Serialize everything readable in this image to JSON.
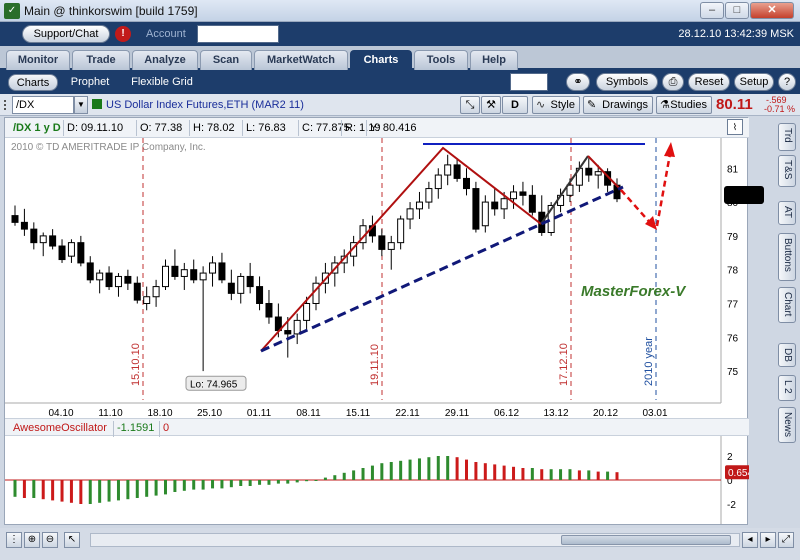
{
  "window": {
    "title": "Main @ thinkorswim [build 1759]",
    "minimize": "–",
    "maximize": "□",
    "close": "✕"
  },
  "toprow": {
    "support": "Support/Chat",
    "alert": "!",
    "account_label": "Account",
    "datetime": "28.12.10 13:42:39 MSK"
  },
  "tabs": [
    {
      "label": "Monitor"
    },
    {
      "label": "Trade"
    },
    {
      "label": "Analyze"
    },
    {
      "label": "Scan"
    },
    {
      "label": "MarketWatch"
    },
    {
      "label": "Charts"
    },
    {
      "label": "Tools"
    },
    {
      "label": "Help"
    }
  ],
  "subtabs": [
    {
      "label": "Charts"
    },
    {
      "label": "Prophet"
    },
    {
      "label": "Flexible Grid"
    }
  ],
  "subrow_buttons": {
    "symbols": "Symbols",
    "reset": "Reset",
    "setup": "Setup"
  },
  "symbol_bar": {
    "symbol": "/DX",
    "description": "US Dollar Index Futures,ETH (MAR2 11)",
    "d_button": "D",
    "style": "Style",
    "drawings": "Drawings",
    "studies": "Studies",
    "last": "80.11",
    "net_change": "-.569",
    "pct_change": "-0.71 %"
  },
  "studies_bar": {
    "symbol": "/DX 1 y D",
    "date": "D: 09.11.10",
    "open": "O: 77.38",
    "high": "H: 78.02",
    "low": "L: 76.83",
    "close": "C: 77.875",
    "range": "R: 1.19",
    "y": "Y: 80.416"
  },
  "copyright": "2010 © TD AMERITRADE IP Company, Inc.",
  "annotations": {
    "low_label": "Lo: 74.965",
    "watermark": "MasterForex-V",
    "v1": "15.10.10",
    "v2": "19.11.10",
    "v3": "17.12.10",
    "v4": "2010 year"
  },
  "oscillator": {
    "name": "AwesomeOscillator",
    "value": "-1.1591",
    "zero": "0",
    "current": "0.65463"
  },
  "side_tabs": [
    {
      "label": "Trd"
    },
    {
      "label": "T&S"
    },
    {
      "label": "AT"
    },
    {
      "label": "Buttons"
    },
    {
      "label": "Chart"
    },
    {
      "label": "DB"
    },
    {
      "label": "L 2"
    },
    {
      "label": "News"
    }
  ],
  "colors": {
    "up": "#000000",
    "down": "#000000",
    "red_line": "#b01010",
    "blue_line": "#1020c0",
    "navy_dash": "#101878",
    "osc_green": "#2e8b2e",
    "osc_red": "#cc1a1a"
  },
  "chart_data": {
    "type": "candlestick",
    "price_axis": {
      "ticks": [
        "81",
        "80",
        "79",
        "78",
        "77",
        "76",
        "75"
      ],
      "range": [
        74.5,
        81.6
      ]
    },
    "date_ticks": [
      "04.10",
      "11.10",
      "18.10",
      "25.10",
      "01.11",
      "08.11",
      "15.11",
      "22.11",
      "29.11",
      "06.12",
      "13.12",
      "20.12",
      "03.01"
    ],
    "candles": [
      [
        79.6,
        79.9,
        79.3,
        79.4
      ],
      [
        79.4,
        79.8,
        79.0,
        79.2
      ],
      [
        79.2,
        79.4,
        78.6,
        78.8
      ],
      [
        78.8,
        79.1,
        78.4,
        79.0
      ],
      [
        79.0,
        79.2,
        78.6,
        78.7
      ],
      [
        78.7,
        78.9,
        78.2,
        78.3
      ],
      [
        78.4,
        78.9,
        78.2,
        78.8
      ],
      [
        78.8,
        79.0,
        78.1,
        78.2
      ],
      [
        78.2,
        78.4,
        77.6,
        77.7
      ],
      [
        77.7,
        78.0,
        77.3,
        77.9
      ],
      [
        77.9,
        78.1,
        77.4,
        77.5
      ],
      [
        77.5,
        77.9,
        77.2,
        77.8
      ],
      [
        77.8,
        78.0,
        77.4,
        77.6
      ],
      [
        77.6,
        77.8,
        77.0,
        77.1
      ],
      [
        77.0,
        77.5,
        76.8,
        77.2
      ],
      [
        77.2,
        77.7,
        76.9,
        77.5
      ],
      [
        77.5,
        78.3,
        77.4,
        78.1
      ],
      [
        78.1,
        78.6,
        77.7,
        77.8
      ],
      [
        77.8,
        78.2,
        77.4,
        78.0
      ],
      [
        78.0,
        78.3,
        77.6,
        77.7
      ],
      [
        77.7,
        78.1,
        75.0,
        77.9
      ],
      [
        77.9,
        78.4,
        77.5,
        78.2
      ],
      [
        78.2,
        78.5,
        77.6,
        77.7
      ],
      [
        77.6,
        78.0,
        77.1,
        77.3
      ],
      [
        77.3,
        77.9,
        77.0,
        77.8
      ],
      [
        77.8,
        78.2,
        77.3,
        77.5
      ],
      [
        77.5,
        77.8,
        76.8,
        77.0
      ],
      [
        77.0,
        77.4,
        76.4,
        76.6
      ],
      [
        76.6,
        77.0,
        76.0,
        76.2
      ],
      [
        76.2,
        76.6,
        75.4,
        76.1
      ],
      [
        76.1,
        76.7,
        75.8,
        76.5
      ],
      [
        76.5,
        77.2,
        76.2,
        77.0
      ],
      [
        77.0,
        77.8,
        76.8,
        77.6
      ],
      [
        77.6,
        78.2,
        77.3,
        77.9
      ],
      [
        77.9,
        78.4,
        77.5,
        78.2
      ],
      [
        78.2,
        78.6,
        77.9,
        78.4
      ],
      [
        78.4,
        79.0,
        78.1,
        78.8
      ],
      [
        78.8,
        79.5,
        78.6,
        79.3
      ],
      [
        79.3,
        79.6,
        78.8,
        79.0
      ],
      [
        79.0,
        79.2,
        78.4,
        78.6
      ],
      [
        78.6,
        79.0,
        78.0,
        78.8
      ],
      [
        78.8,
        79.6,
        78.6,
        79.5
      ],
      [
        79.5,
        80.0,
        79.2,
        79.8
      ],
      [
        79.8,
        80.3,
        79.5,
        80.0
      ],
      [
        80.0,
        80.6,
        79.8,
        80.4
      ],
      [
        80.4,
        81.0,
        80.1,
        80.8
      ],
      [
        80.8,
        81.4,
        80.5,
        81.1
      ],
      [
        81.1,
        81.3,
        80.6,
        80.7
      ],
      [
        80.7,
        81.0,
        80.2,
        80.4
      ],
      [
        80.4,
        80.6,
        79.1,
        79.2
      ],
      [
        79.3,
        80.2,
        79.1,
        80.0
      ],
      [
        80.0,
        80.4,
        79.6,
        79.8
      ],
      [
        79.8,
        80.3,
        79.5,
        80.1
      ],
      [
        80.1,
        80.5,
        79.8,
        80.3
      ],
      [
        80.3,
        80.6,
        79.9,
        80.2
      ],
      [
        80.2,
        80.5,
        79.6,
        79.7
      ],
      [
        79.7,
        80.2,
        79.0,
        79.1
      ],
      [
        79.1,
        80.0,
        79.0,
        79.9
      ],
      [
        79.9,
        80.4,
        79.7,
        80.2
      ],
      [
        80.2,
        80.7,
        80.0,
        80.5
      ],
      [
        80.5,
        81.2,
        80.3,
        81.0
      ],
      [
        81.0,
        81.3,
        80.6,
        80.8
      ],
      [
        80.8,
        81.1,
        80.4,
        80.9
      ],
      [
        80.9,
        81.0,
        80.3,
        80.5
      ],
      [
        80.5,
        80.7,
        80.0,
        80.1
      ]
    ],
    "awesome_oscillator": [
      -1.4,
      -1.5,
      -1.5,
      -1.6,
      -1.7,
      -1.8,
      -1.9,
      -2.0,
      -2.0,
      -1.9,
      -1.8,
      -1.7,
      -1.6,
      -1.5,
      -1.4,
      -1.3,
      -1.2,
      -1.0,
      -0.9,
      -0.8,
      -0.8,
      -0.7,
      -0.7,
      -0.6,
      -0.5,
      -0.5,
      -0.4,
      -0.4,
      -0.3,
      -0.3,
      -0.2,
      -0.1,
      0.0,
      0.2,
      0.4,
      0.6,
      0.8,
      1.0,
      1.2,
      1.4,
      1.5,
      1.6,
      1.7,
      1.8,
      1.9,
      2.0,
      2.0,
      1.9,
      1.7,
      1.5,
      1.4,
      1.3,
      1.2,
      1.1,
      1.0,
      1.0,
      0.9,
      0.9,
      0.9,
      0.9,
      0.8,
      0.8,
      0.7,
      0.7,
      0.65
    ],
    "oscillator_axis": {
      "ticks": [
        "2",
        "0",
        "-2"
      ],
      "range": [
        -3,
        3
      ]
    }
  }
}
